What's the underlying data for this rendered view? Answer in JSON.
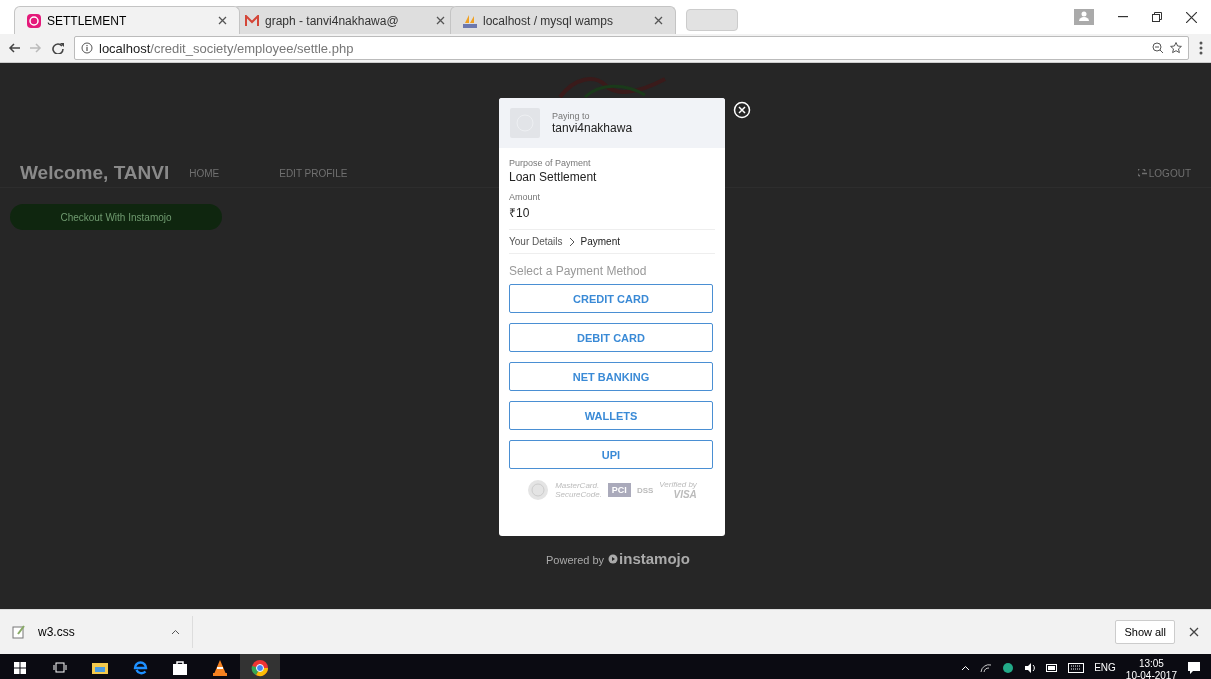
{
  "tabs": [
    {
      "title": "SETTLEMENT",
      "selected": true
    },
    {
      "title": "graph - tanvi4nakhawa@",
      "selected": false
    },
    {
      "title": "localhost / mysql wamps",
      "selected": false
    }
  ],
  "address_bar": {
    "host": "localhost",
    "path": "/credit_society/employee/settle.php"
  },
  "page": {
    "welcome": "Welcome, TANVI",
    "nav": [
      "HOME",
      "EDIT PROFILE"
    ],
    "logout": "LOGOUT",
    "checkout_button": "Checkout With Instamojo"
  },
  "payment_modal": {
    "paying_to_label": "Paying to",
    "payee": "tanvi4nakhawa",
    "purpose_label": "Purpose of Payment",
    "purpose": "Loan Settlement",
    "amount_label": "Amount",
    "amount": "₹10",
    "steps": [
      {
        "label": "Your Details",
        "selected": false
      },
      {
        "label": "Payment",
        "selected": true
      }
    ],
    "method_heading": "Select a Payment Method",
    "methods": [
      "CREDIT CARD",
      "DEBIT CARD",
      "NET BANKING",
      "WALLETS",
      "UPI"
    ],
    "badges": {
      "mastercard": [
        "MasterCard.",
        "SecureCode."
      ],
      "pci": "PCI",
      "dss": "DSS",
      "visa": [
        "Verified by",
        "VISA"
      ]
    },
    "powered_by": "Powered by",
    "brand": "instamojo"
  },
  "download_bar": {
    "file": "w3.css",
    "show_all": "Show all"
  },
  "taskbar": {
    "lang": "ENG",
    "time": "13:05",
    "date": "10-04-2017"
  }
}
